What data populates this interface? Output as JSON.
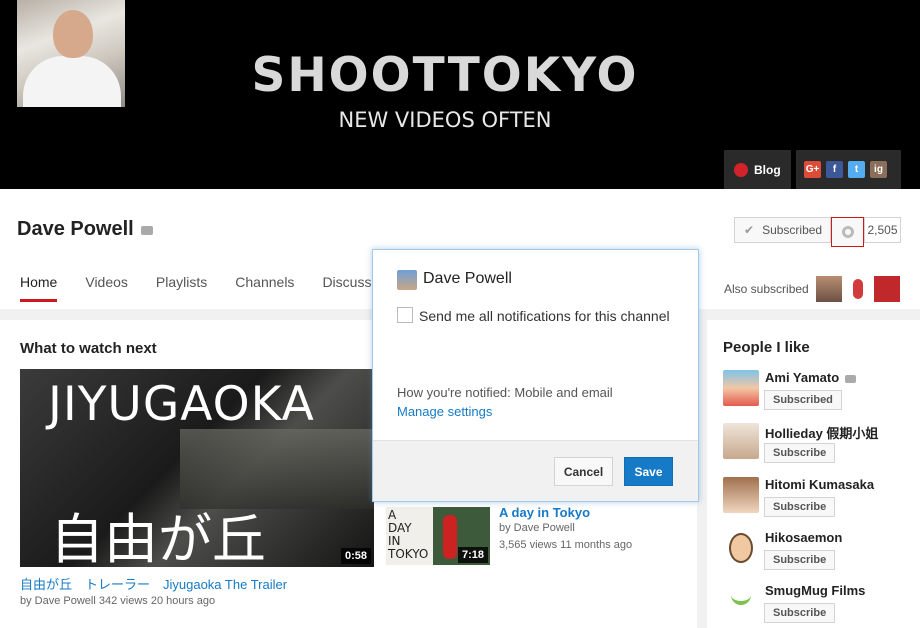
{
  "banner": {
    "title": "SHOOTTOKYO",
    "subtitle": "NEW VIDEOS OFTEN",
    "blog_label": "Blog",
    "social": [
      "G+",
      "f",
      "t",
      "ig"
    ]
  },
  "channel": {
    "name": "Dave Powell",
    "subscribe_label": "Subscribed",
    "subscriber_count": "2,505",
    "tabs": [
      "Home",
      "Videos",
      "Playlists",
      "Channels",
      "Discuss"
    ],
    "also_subscribed_label": "Also subscribed"
  },
  "main": {
    "section_title": "What to watch next",
    "featured": {
      "thumb_text_top": "JIYUGAOKA",
      "thumb_text_bottom": "自由が丘",
      "duration": "0:58",
      "title": "自由が丘　トレーラー　Jiyugaoka The Trailer",
      "meta": "by Dave Powell   342 views   20 hours ago"
    },
    "second": {
      "thumb_text": "A\nDAY\nIN\nTOKYO",
      "duration": "7:18",
      "title": "A day in Tokyo",
      "by": "by Dave Powell",
      "meta": "3,565 views   11 months ago"
    }
  },
  "sidebar": {
    "title": "People I like",
    "people": [
      {
        "name": "Ami Yamato",
        "button": "Subscribed",
        "color": "#e58a7a"
      },
      {
        "name": "Hollieday 假期小姐",
        "button": "Subscribe",
        "color": "#d8c4b0"
      },
      {
        "name": "Hitomi Kumasaka",
        "button": "Subscribe",
        "color": "#c9a07a"
      },
      {
        "name": "Hikosaemon",
        "button": "Subscribe",
        "color": "#8aa6c2"
      },
      {
        "name": "SmugMug Films",
        "button": "Subscribe",
        "color": "#7bc34a"
      }
    ]
  },
  "popup": {
    "channel_name": "Dave Powell",
    "checkbox_label": "Send me all notifications for this channel",
    "notified_text": "How you're notified: Mobile and email",
    "manage_link": "Manage settings",
    "cancel_label": "Cancel",
    "save_label": "Save"
  }
}
